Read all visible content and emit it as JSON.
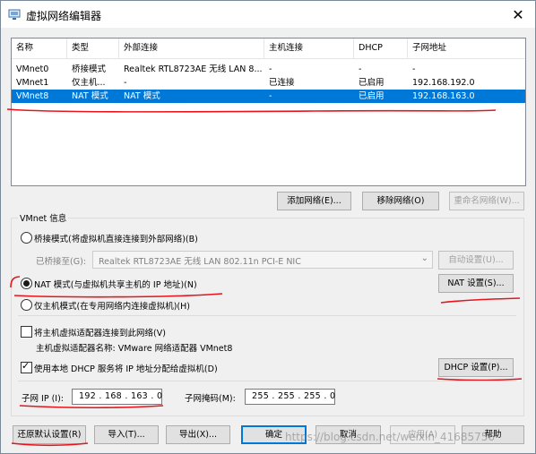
{
  "window": {
    "title": "虚拟网络编辑器",
    "close_glyph": "✕"
  },
  "table": {
    "columns": [
      "名称",
      "类型",
      "外部连接",
      "主机连接",
      "DHCP",
      "子网地址"
    ],
    "rows": [
      {
        "name": "VMnet0",
        "type": "桥接模式",
        "external": "Realtek RTL8723AE 无线 LAN 8...",
        "host": "-",
        "dhcp": "-",
        "subnet": "-"
      },
      {
        "name": "VMnet1",
        "type": "仅主机...",
        "external": "-",
        "host": "已连接",
        "dhcp": "已启用",
        "subnet": "192.168.192.0"
      },
      {
        "name": "VMnet8",
        "type": "NAT 模式",
        "external": "NAT 模式",
        "host": "-",
        "dhcp": "已启用",
        "subnet": "192.168.163.0"
      }
    ],
    "selected_row": 2
  },
  "list_buttons": {
    "add": "添加网络(E)...",
    "remove": "移除网络(O)",
    "rename": "重命名网络(W)..."
  },
  "vmnet_info": {
    "title": "VMnet 信息",
    "bridge_radio": "桥接模式(将虚拟机直接连接到外部网络)(B)",
    "bridged_to_label": "已桥接至(G):",
    "bridged_to_value": "Realtek RTL8723AE 无线 LAN 802.11n PCI-E NIC",
    "auto_settings": "自动设置(U)...",
    "nat_radio": "NAT 模式(与虚拟机共享主机的 IP 地址)(N)",
    "nat_settings": "NAT 设置(S)...",
    "hostonly_radio": "仅主机模式(在专用网络内连接虚拟机)(H)",
    "connect_adapter": "将主机虚拟适配器连接到此网络(V)",
    "adapter_name": "主机虚拟适配器名称: VMware 网络适配器 VMnet8",
    "use_dhcp": "使用本地 DHCP 服务将 IP 地址分配给虚拟机(D)",
    "dhcp_settings": "DHCP 设置(P)...",
    "subnet_ip_label": "子网 IP (I):",
    "subnet_ip": "192 . 168 . 163 .  0",
    "subnet_mask_label": "子网掩码(M):",
    "subnet_mask": "255 . 255 . 255 .  0",
    "selected_mode": "nat",
    "connect_adapter_checked": false,
    "use_dhcp_checked": true
  },
  "footer_buttons": {
    "restore": "还原默认设置(R)",
    "import": "导入(T)...",
    "export": "导出(X)...",
    "ok": "确定",
    "cancel": "取消",
    "apply": "应用(A)",
    "help": "帮助"
  },
  "watermark": "https://blog.csdn.net/weixin_41685756",
  "colors": {
    "selection": "#0078d7",
    "annotation_red": "#e8141c"
  }
}
